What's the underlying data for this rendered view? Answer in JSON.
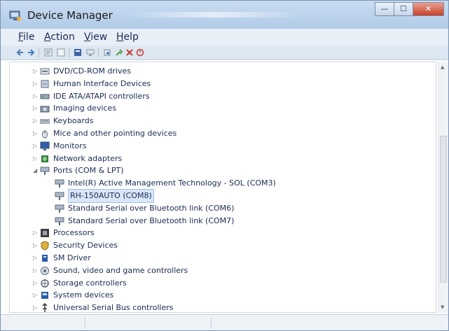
{
  "window": {
    "title": "Device Manager"
  },
  "menu": [
    {
      "accel": "F",
      "rest": "ile"
    },
    {
      "accel": "A",
      "rest": "ction"
    },
    {
      "accel": "V",
      "rest": "iew"
    },
    {
      "accel": "H",
      "rest": "elp"
    }
  ],
  "toolbar": {
    "icons": [
      "back-arrow-icon",
      "forward-arrow-icon",
      "properties-icon",
      "show-hide-icon",
      "help-icon",
      "computer-icon",
      "scan-hardware-icon",
      "update-driver-icon",
      "uninstall-icon",
      "disable-icon"
    ]
  },
  "tree": {
    "items": [
      {
        "label": "DVD/CD-ROM drives",
        "icon": "dvd-drive-icon",
        "state": "collapsed"
      },
      {
        "label": "Human Interface Devices",
        "icon": "hid-icon",
        "state": "collapsed"
      },
      {
        "label": "IDE ATA/ATAPI controllers",
        "icon": "ide-controller-icon",
        "state": "collapsed"
      },
      {
        "label": "Imaging devices",
        "icon": "imaging-device-icon",
        "state": "collapsed"
      },
      {
        "label": "Keyboards",
        "icon": "keyboard-icon",
        "state": "collapsed"
      },
      {
        "label": "Mice and other pointing devices",
        "icon": "mouse-icon",
        "state": "collapsed"
      },
      {
        "label": "Monitors",
        "icon": "monitor-icon",
        "state": "collapsed"
      },
      {
        "label": "Network adapters",
        "icon": "network-adapter-icon",
        "state": "collapsed"
      },
      {
        "label": "Ports (COM & LPT)",
        "icon": "port-icon",
        "state": "expanded"
      },
      {
        "label": "Intel(R) Active Management Technology - SOL (COM3)",
        "icon": "port-icon",
        "child": true
      },
      {
        "label": "RH-150AUTO (COM8)",
        "icon": "port-icon",
        "child": true,
        "selected": true
      },
      {
        "label": "Standard Serial over Bluetooth link (COM6)",
        "icon": "port-icon",
        "child": true
      },
      {
        "label": "Standard Serial over Bluetooth link (COM7)",
        "icon": "port-icon",
        "child": true
      },
      {
        "label": "Processors",
        "icon": "processor-icon",
        "state": "collapsed"
      },
      {
        "label": "Security Devices",
        "icon": "security-device-icon",
        "state": "collapsed"
      },
      {
        "label": "SM Driver",
        "icon": "sm-driver-icon",
        "state": "collapsed"
      },
      {
        "label": "Sound, video and game controllers",
        "icon": "sound-icon",
        "state": "collapsed"
      },
      {
        "label": "Storage controllers",
        "icon": "storage-controller-icon",
        "state": "collapsed"
      },
      {
        "label": "System devices",
        "icon": "system-device-icon",
        "state": "collapsed"
      },
      {
        "label": "Universal Serial Bus controllers",
        "icon": "usb-icon",
        "state": "collapsed"
      }
    ]
  },
  "colors": {
    "title_bar": "#c9dcf1",
    "selection": "#d8e7f8",
    "text": "#1b2a55"
  }
}
